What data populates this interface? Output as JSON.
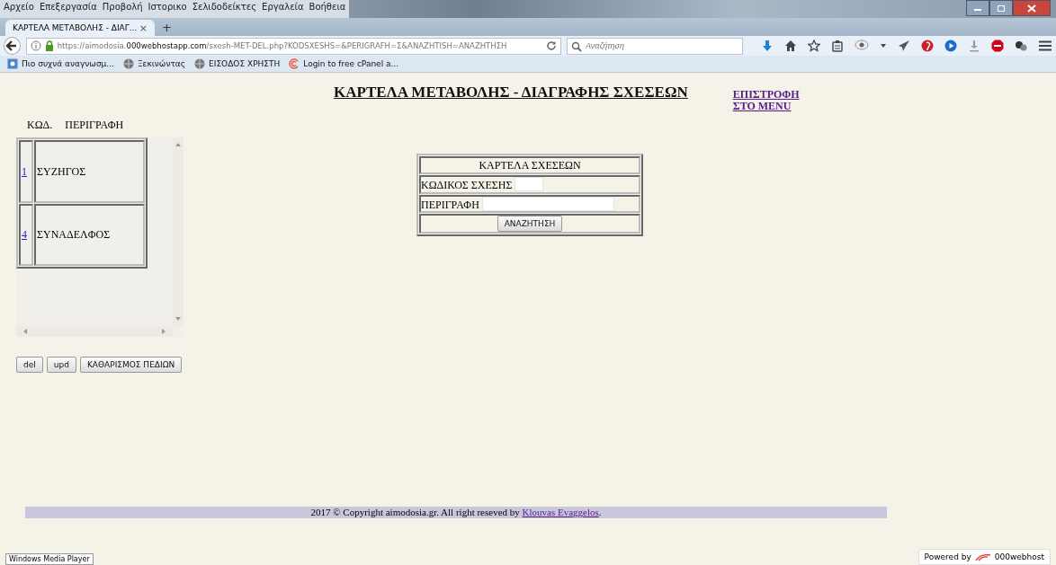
{
  "menu_bar": [
    "Αρχείο",
    "Επεξεργασία",
    "Προβολή",
    "Ιστορικο",
    "Σελιδοδείκτες",
    "Εργαλεία",
    "Βοήθεια"
  ],
  "tabs": [
    {
      "label": "ΚΑΡΤΕΛΑ ΜΕΤΑΒΟΛΗΣ - ΔΙΑΓ...",
      "close": "×",
      "selected": true
    }
  ],
  "new_tab": "+",
  "address_bar": {
    "url_host_pre": "https://aimodosia.",
    "url_host": "000webhostapp.com",
    "url_path": "/sxesh-MET-DEL.php?KODSXESHS=&PERIGRAFH=Σ&ANAZHTISH=ΑΝΑΖΗΤΗΣΗ",
    "search_placeholder": "Αναζήτηση"
  },
  "bookmarks": [
    "Πιο συχνά αναγνωσμ...",
    "Ξεκινώντας",
    "ΕΙΣΟΔΟΣ ΧΡΗΣΤΗ",
    "Login to free cPanel a..."
  ],
  "page": {
    "title": "ΚΑΡΤΕΛΑ ΜΕΤΑΒΟΛΗΣ - ΔΙΑΓΡΑΦΗΣ ΣΧΕΣΕΩΝ",
    "back_link": "ΕΠΙΣΤΡΟΦΗ ΣΤΟ MENU",
    "list_columns": [
      "ΚΩΔ.",
      "ΠΕΡΙΓΡΑΦΗ"
    ],
    "list_rows": [
      {
        "code": "1",
        "description": "ΣΥΖΗΓΟΣ"
      },
      {
        "code": "4",
        "description": "ΣΥΝΑΔΕΛΦΟΣ"
      }
    ],
    "buttons": [
      "del",
      "upd",
      "ΚΑΘΑΡΙΣΜΟΣ ΠΕΔΙΩΝ"
    ],
    "form": {
      "title": "ΚΑΡΤΕΛΑ ΣΧΕΣΕΩΝ",
      "code_label": "ΚΩΔΙΚΟΣ ΣΧΕΣΗΣ",
      "description_label": "ΠΕΡΙΓΡΑΦΗ",
      "search_button": "ΑΝΑΖΗΤΗΣΗ"
    },
    "footer": {
      "text": "2017 © Copyright aimodosia.gr. All right reseved by ",
      "link": "Klouvas Evaggelos",
      "end": "."
    },
    "taskbar_tooltip": "Windows Media Player",
    "powered_by": {
      "text": "Powered by",
      "brand": "000webhost"
    }
  }
}
